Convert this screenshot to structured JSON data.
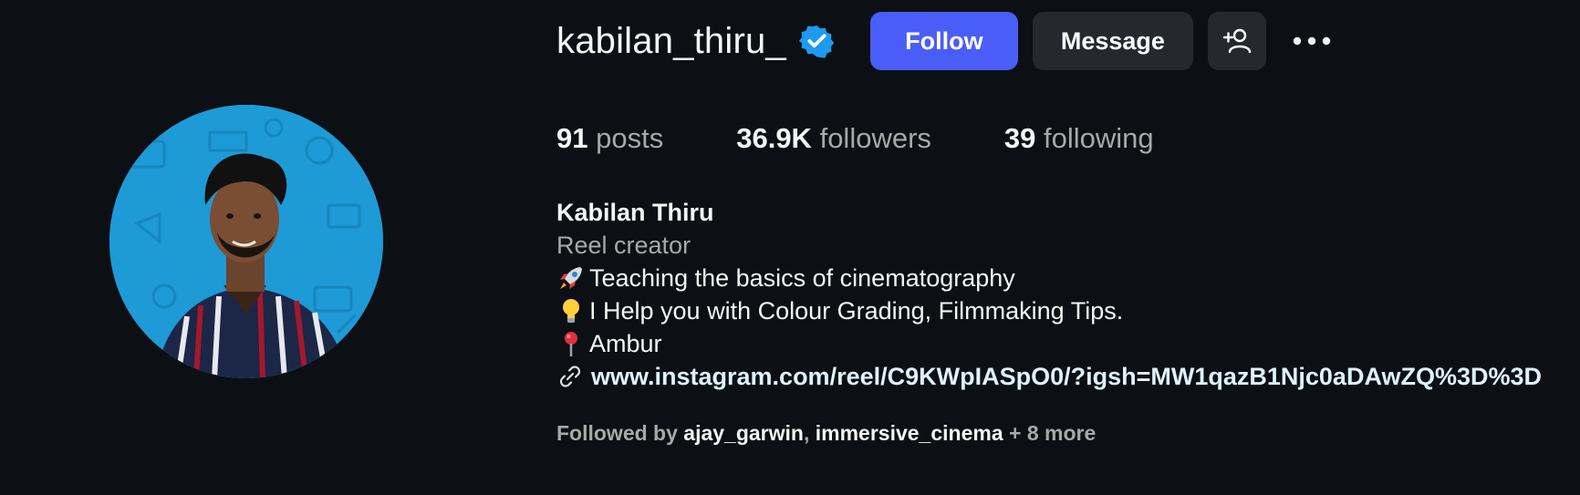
{
  "profile": {
    "username": "kabilan_thiru_",
    "verified": true,
    "full_name": "Kabilan Thiru",
    "category": "Reel creator",
    "bio": [
      {
        "icon": "rocket-icon",
        "text": "Teaching the basics of cinematography"
      },
      {
        "icon": "lightbulb-icon",
        "text": "I Help you with Colour Grading, Filmmaking Tips."
      },
      {
        "icon": "pin-icon",
        "text": "Ambur"
      }
    ],
    "link": "www.instagram.com/reel/C9KWpIASpO0/?igsh=MW1qazB1Njc0aDAwZQ%3D%3D"
  },
  "actions": {
    "follow_label": "Follow",
    "message_label": "Message",
    "add_icon": "person-add-icon",
    "more_icon": "more-options-icon"
  },
  "stats": {
    "posts_count": "91",
    "posts_label": "posts",
    "followers_count": "36.9K",
    "followers_label": "followers",
    "following_count": "39",
    "following_label": "following"
  },
  "followed_by": {
    "prefix": "Followed by",
    "users": [
      "ajay_garwin",
      "immersive_cinema"
    ],
    "separator": ",",
    "more": "+ 8 more"
  },
  "colors": {
    "background": "#0c1014",
    "follow_button": "#4a5df9",
    "secondary_button": "#25292e",
    "verified_badge": "#1d9bf0",
    "muted_text": "#a8a8a8"
  }
}
